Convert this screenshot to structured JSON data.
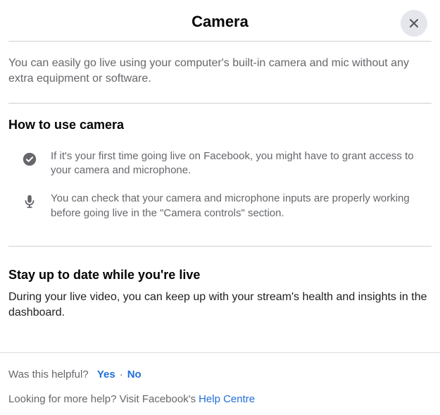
{
  "header": {
    "title": "Camera"
  },
  "intro": "You can easily go live using your computer's built-in camera and mic without any extra equipment or software.",
  "section1": {
    "title": "How to use camera",
    "tips": [
      "If it's your first time going live on Facebook, you might have to grant access to your camera and microphone.",
      "You can check that your camera and microphone inputs are properly working before going live in the \"Camera controls\" section."
    ]
  },
  "section2": {
    "title": "Stay up to date while you're live",
    "body": "During your live video, you can keep up with your stream's health and insights in the dashboard."
  },
  "footer": {
    "helpful_prompt": "Was this helpful?",
    "yes": "Yes",
    "separator": "·",
    "no": "No",
    "more_help_prefix": "Looking for more help? Visit Facebook's ",
    "help_centre": "Help Centre"
  }
}
